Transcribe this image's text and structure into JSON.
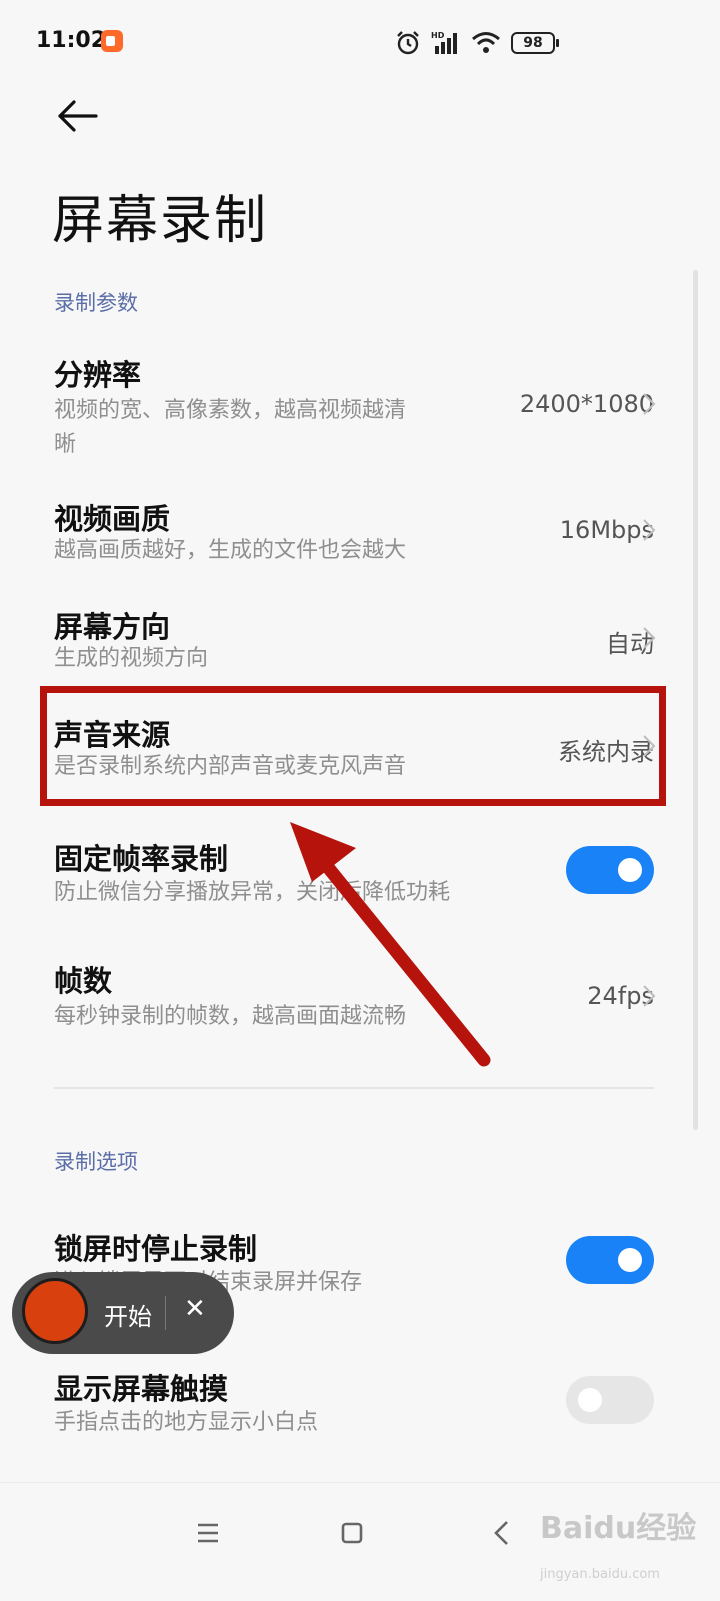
{
  "status": {
    "time": "11:02",
    "battery": "98"
  },
  "page": {
    "title": "屏幕录制"
  },
  "sections": {
    "params": "录制参数",
    "options": "录制选项"
  },
  "settings": {
    "resolution": {
      "title": "分辨率",
      "sub1": "视频的宽、高像素数，越高视频越清",
      "sub2": "晰",
      "value": "2400*1080"
    },
    "quality": {
      "title": "视频画质",
      "sub": "越高画质越好，生成的文件也会越大",
      "value": "16Mbps"
    },
    "orientation": {
      "title": "屏幕方向",
      "sub": "生成的视频方向",
      "value": "自动"
    },
    "audio_source": {
      "title": "声音来源",
      "sub": "是否录制系统内部声音或麦克风声音",
      "value": "系统内录"
    },
    "fixed_framerate": {
      "title": "固定帧率录制",
      "sub": "防止微信分享播放异常，关闭后降低功耗",
      "enabled": true
    },
    "framerate": {
      "title": "帧数",
      "sub": "每秒钟录制的帧数，越高画面越流畅",
      "value": "24fps"
    },
    "stop_on_lock": {
      "title": "锁屏时停止录制",
      "sub": "进入锁屏界面时结束录屏并保存",
      "enabled": true
    },
    "show_touches": {
      "title": "显示屏幕触摸",
      "sub": "手指点击的地方显示小白点",
      "enabled": false
    }
  },
  "floating": {
    "start": "开始",
    "close": "✕"
  },
  "watermark": {
    "main": "Baidu经验",
    "sub": "jingyan.baidu.com"
  },
  "colors": {
    "accent": "#1a82f7",
    "annotation": "#b5130c",
    "record": "#d8410e"
  }
}
